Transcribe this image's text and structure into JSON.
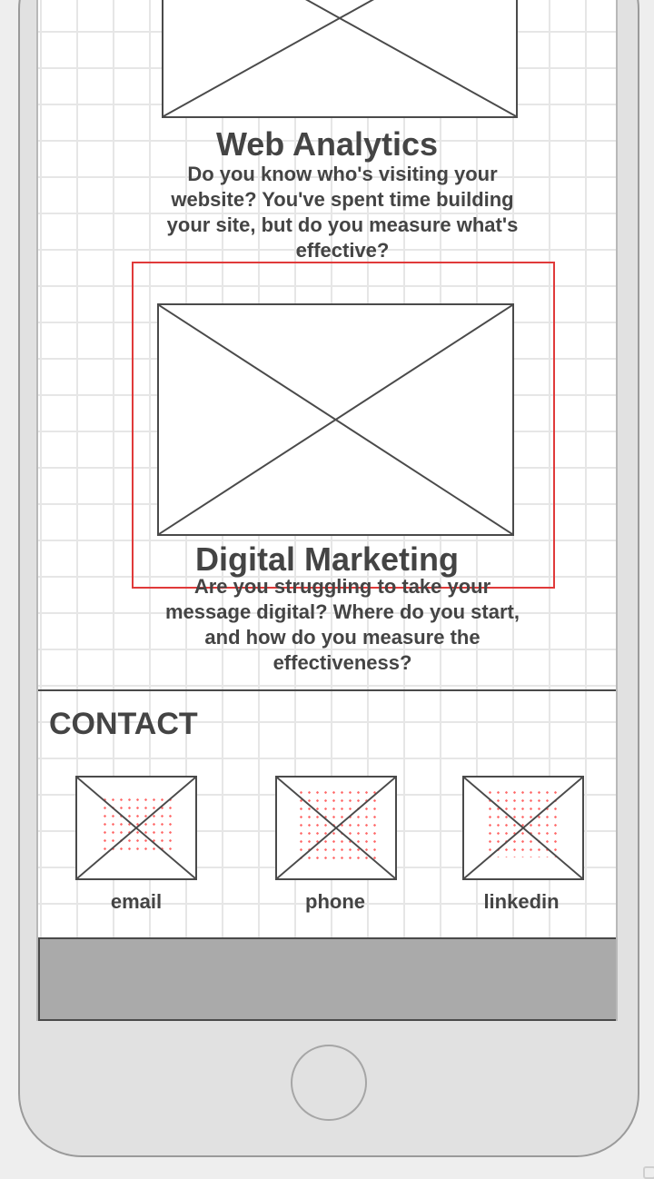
{
  "services": [
    {
      "title": "Web Analytics",
      "lines": [
        "Do you know who's visiting your",
        "website? You've spent time building",
        "your site, but do you measure what's",
        "effective?"
      ]
    },
    {
      "title": "Digital Marketing",
      "lines": [
        "Are you struggling to take your",
        "message digital? Where do you start,",
        "and how do you measure the",
        "effectiveness?"
      ]
    }
  ],
  "contact": {
    "heading": "CONTACT",
    "items": [
      {
        "label": "email",
        "icon": "email-icon-placeholder"
      },
      {
        "label": "phone",
        "icon": "phone-icon-placeholder"
      },
      {
        "label": "linkedin",
        "icon": "linkedin-icon-placeholder"
      }
    ]
  },
  "colors": {
    "selection": "#e03a3a",
    "footer": "#aaaaaa",
    "text": "#444444"
  }
}
